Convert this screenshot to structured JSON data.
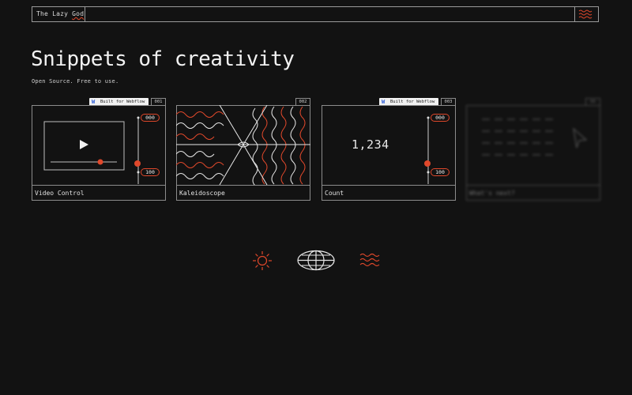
{
  "header": {
    "brand_prefix": "The Lazy ",
    "brand_underlined": "God"
  },
  "hero": {
    "title": "Snippets of creativity",
    "subtitle": "Open Source. Free to use."
  },
  "cards": [
    {
      "label": "Video Control",
      "number": "001",
      "badge": "Built for Webflow",
      "slider_top": "000",
      "slider_bottom": "100"
    },
    {
      "label": "Kaleidoscope",
      "number": "002"
    },
    {
      "label": "Count",
      "number": "003",
      "badge": "Built for Webflow",
      "slider_top": "000",
      "slider_bottom": "100",
      "count_value": "1,234"
    },
    {
      "label": "What's next?",
      "number": "04"
    }
  ],
  "colors": {
    "background": "#121212",
    "accent": "#e0482b",
    "line": "#8c8c8c"
  },
  "icons": [
    "menu-wave-icon",
    "sun-icon",
    "globe-icon",
    "waves-icon",
    "play-icon",
    "webflow-logo-icon",
    "cursor-arrow-icon"
  ]
}
